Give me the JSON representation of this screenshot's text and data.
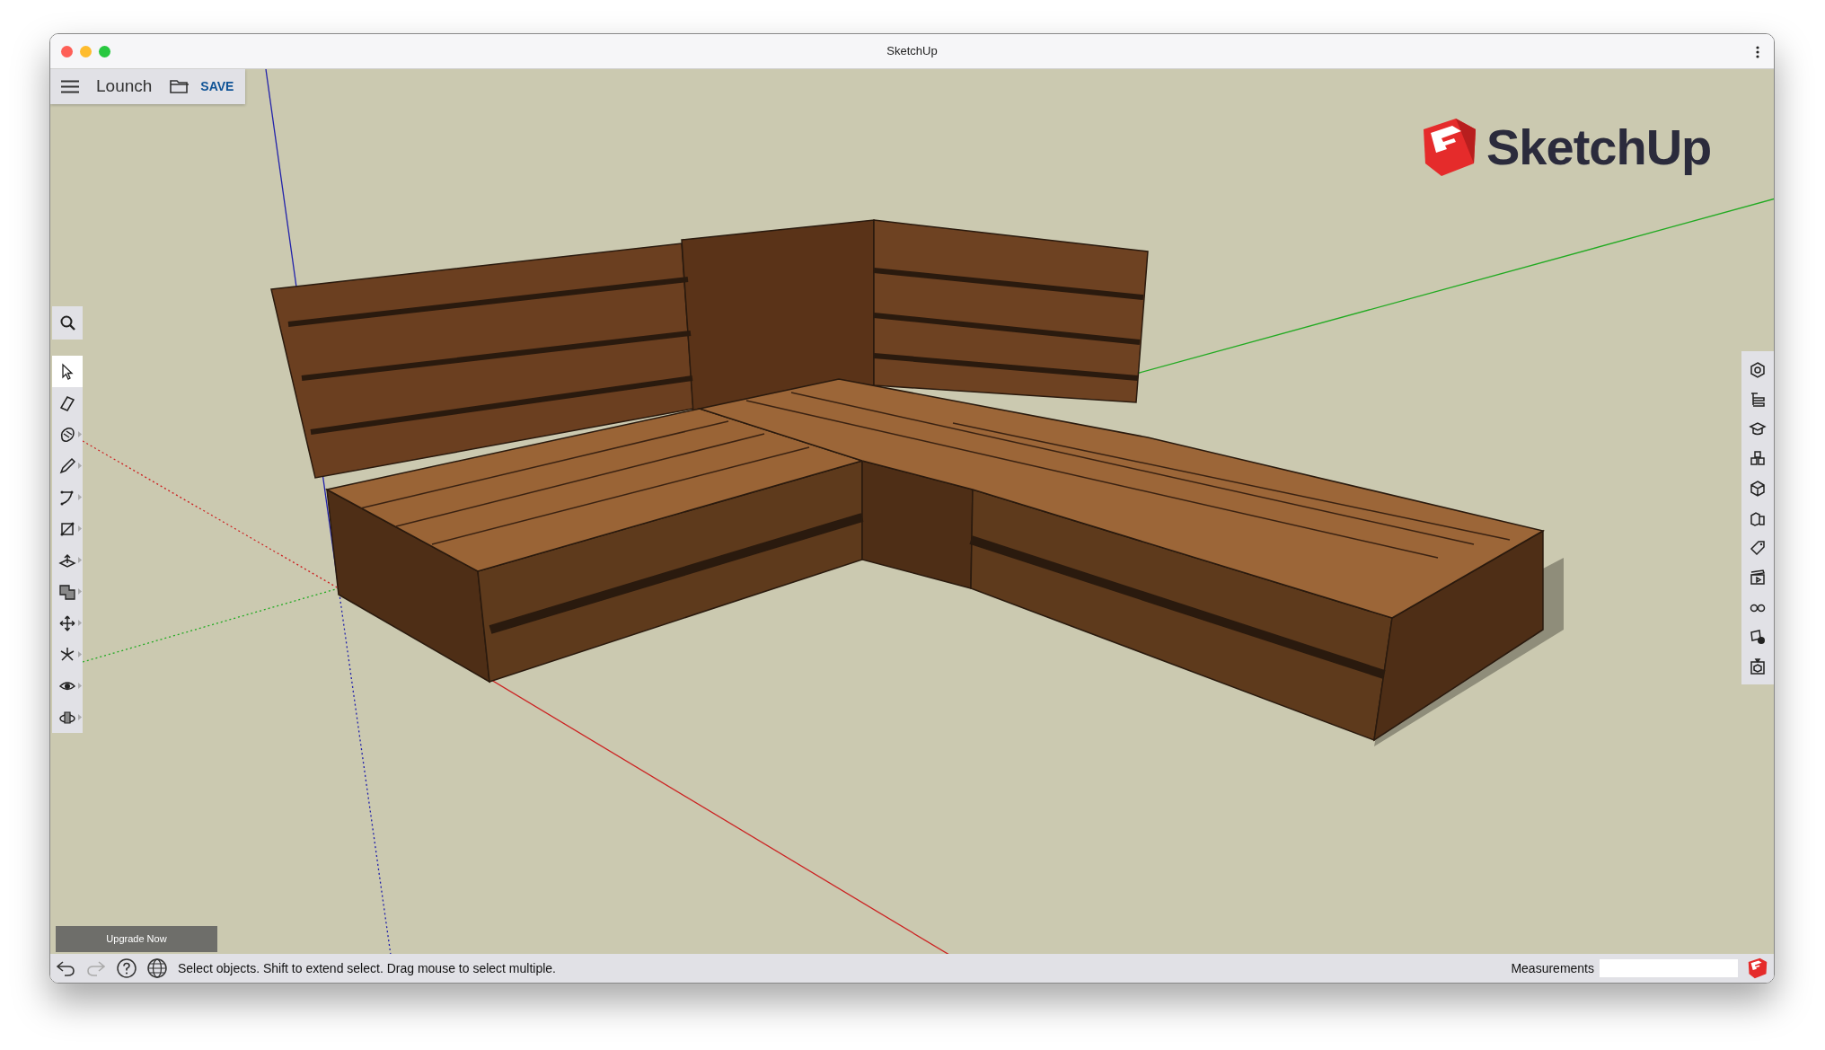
{
  "window": {
    "title": "SketchUp"
  },
  "toolbar": {
    "file_name": "Lounch",
    "save_label": "SAVE"
  },
  "logo": {
    "text": "SketchUp"
  },
  "left_tools": [
    {
      "selected": true,
      "flyout": false
    },
    {
      "selected": false,
      "flyout": false
    },
    {
      "selected": false,
      "flyout": true
    },
    {
      "selected": false,
      "flyout": true
    },
    {
      "selected": false,
      "flyout": true
    },
    {
      "selected": false,
      "flyout": true
    },
    {
      "selected": false,
      "flyout": true
    },
    {
      "selected": false,
      "flyout": true
    },
    {
      "selected": false,
      "flyout": true
    },
    {
      "selected": false,
      "flyout": true
    },
    {
      "selected": false,
      "flyout": true
    },
    {
      "selected": false,
      "flyout": true
    }
  ],
  "upgrade_button": "Upgrade Now",
  "status_bar": {
    "undo": {
      "disabled": false
    },
    "redo": {
      "disabled": true
    },
    "hint": "Select objects. Shift to extend select. Drag mouse to select multiple.",
    "measurements_label": "Measurements"
  }
}
